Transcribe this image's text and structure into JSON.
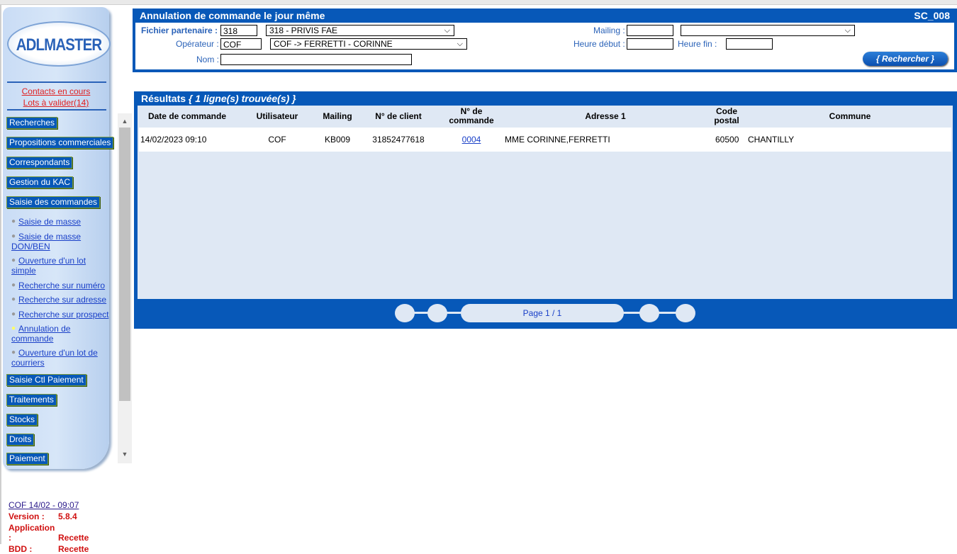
{
  "sidebar": {
    "logo": "ADLMASTER",
    "contacts_link": "Contacts en cours",
    "lots_link": "Lots à valider(14)",
    "menu": [
      "Recherches",
      "Propositions commerciales",
      "Correspondants",
      "Gestion du KAC",
      "Saisie des commandes"
    ],
    "submenu": [
      [
        "Saisie de masse"
      ],
      [
        "Saisie de masse",
        "DON/BEN"
      ],
      [
        "Ouverture d'un lot",
        "simple"
      ],
      [
        "Recherche sur numéro"
      ],
      [
        "Recherche sur adresse"
      ],
      [
        "Recherche sur prospect"
      ],
      [
        "Annulation de",
        "commande"
      ],
      [
        "Ouverture d'un lot de",
        "courriers"
      ]
    ],
    "menu2": [
      "Saisie Ctl Paiement",
      "Traitements",
      "Stocks",
      "Droits",
      "Paiement"
    ]
  },
  "footer": {
    "session": "COF 14/02 - 09:07",
    "version_label": "Version :",
    "version_value": "5.8.4",
    "application_label": "Application :",
    "application_value": "Recette",
    "bdd_label": "BDD :",
    "bdd_value": "Recette"
  },
  "search": {
    "title": "Annulation de commande le jour même",
    "code": "SC_008",
    "partner_label": "Fichier partenaire :",
    "partner_code": "318",
    "partner_select": "318 - PRIVIS FAE",
    "operator_label": "Opérateur :",
    "operator_code": "COF",
    "operator_select": "COF -> FERRETTI - CORINNE",
    "name_label": "Nom :",
    "name_value": "",
    "mailing_label": "Mailing :",
    "mailing_value": "",
    "mailing_select": "",
    "start_label": "Heure début :",
    "start_value": "",
    "end_label": "Heure fin :",
    "end_value": "",
    "button": "{ Rechercher }"
  },
  "results": {
    "title": "Résultats",
    "count": "{ 1 ligne(s) trouvée(s) }",
    "columns": {
      "date": "Date de commande",
      "user": "Utilisateur",
      "mailing": "Mailing",
      "client": "N° de client",
      "order_1": "N° de",
      "order_2": "commande",
      "address": "Adresse 1",
      "postal_1": "Code",
      "postal_2": "postal",
      "city": "Commune"
    },
    "rows": [
      {
        "date": "14/02/2023 09:10",
        "user": "COF",
        "mailing": "KB009",
        "client": "31852477618",
        "order": "0004",
        "address": "MME CORINNE,FERRETTI",
        "postal": "60500",
        "city": "CHANTILLY"
      }
    ],
    "page": "Page 1 / 1"
  },
  "colors": {
    "primary_blue": "#0758b8",
    "panel_light": "#dfe8f4",
    "link_red": "#e02020"
  }
}
